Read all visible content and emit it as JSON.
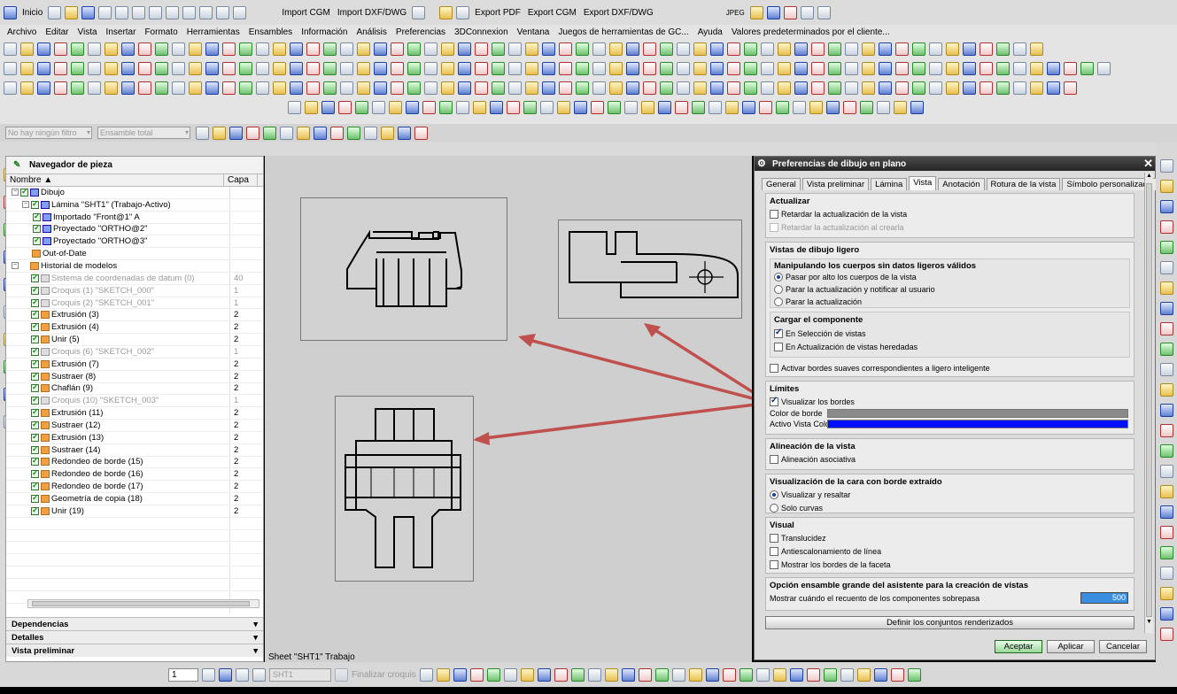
{
  "toolbar_top": {
    "start": "Inicio",
    "import_cgm": "Import CGM",
    "import_dxf": "Import DXF/DWG",
    "export_pdf": "Export PDF",
    "export_cgm": "Export CGM",
    "export_dxf": "Export DXF/DWG",
    "jpeg": "JPEG"
  },
  "menu": [
    "Archivo",
    "Editar",
    "Vista",
    "Insertar",
    "Formato",
    "Herramientas",
    "Ensambles",
    "Información",
    "Análisis",
    "Preferencias",
    "3DConnexion",
    "Ventana",
    "Juegos de herramientas de GC...",
    "Ayuda",
    "Valores predeterminados por el cliente..."
  ],
  "filter": {
    "filter_placeholder": "No hay ningún filtro",
    "scope": "Ensamble total"
  },
  "navigator": {
    "title": "Navegador de pieza",
    "col_name": "Nombre",
    "col_layer": "Capa",
    "rows": [
      {
        "label": "Dibujo",
        "layer": "",
        "level": 0
      },
      {
        "label": "Lámina \"SHT1\" (Trabajo-Activo)",
        "layer": "",
        "level": 1
      },
      {
        "label": "Importado \"Front@1\" A",
        "layer": "",
        "level": 2
      },
      {
        "label": "Proyectado \"ORTHO@2\"",
        "layer": "",
        "level": 2
      },
      {
        "label": "Proyectado \"ORTHO@3\"",
        "layer": "",
        "level": 2
      },
      {
        "label": "Out-of-Date",
        "layer": "",
        "level": 1
      },
      {
        "label": "Historial de modelos",
        "layer": "",
        "level": 0
      },
      {
        "label": "Sistema de coordenadas de datum (0)",
        "layer": "40",
        "level": 1,
        "dim": true
      },
      {
        "label": "Croquis (1) \"SKETCH_000\"",
        "layer": "1",
        "level": 1,
        "dim": true
      },
      {
        "label": "Croquis (2) \"SKETCH_001\"",
        "layer": "1",
        "level": 1,
        "dim": true
      },
      {
        "label": "Extrusión (3)",
        "layer": "2",
        "level": 1
      },
      {
        "label": "Extrusión (4)",
        "layer": "2",
        "level": 1
      },
      {
        "label": "Unir (5)",
        "layer": "2",
        "level": 1
      },
      {
        "label": "Croquis (6) \"SKETCH_002\"",
        "layer": "1",
        "level": 1,
        "dim": true
      },
      {
        "label": "Extrusión (7)",
        "layer": "2",
        "level": 1
      },
      {
        "label": "Sustraer (8)",
        "layer": "2",
        "level": 1
      },
      {
        "label": "Chaflán (9)",
        "layer": "2",
        "level": 1
      },
      {
        "label": "Croquis (10) \"SKETCH_003\"",
        "layer": "1",
        "level": 1,
        "dim": true
      },
      {
        "label": "Extrusión (11)",
        "layer": "2",
        "level": 1
      },
      {
        "label": "Sustraer (12)",
        "layer": "2",
        "level": 1
      },
      {
        "label": "Extrusión (13)",
        "layer": "2",
        "level": 1
      },
      {
        "label": "Sustraer (14)",
        "layer": "2",
        "level": 1
      },
      {
        "label": "Redondeo de borde (15)",
        "layer": "2",
        "level": 1
      },
      {
        "label": "Redondeo de borde (16)",
        "layer": "2",
        "level": 1
      },
      {
        "label": "Redondeo de borde (17)",
        "layer": "2",
        "level": 1
      },
      {
        "label": "Geometría de copia (18)",
        "layer": "2",
        "level": 1
      },
      {
        "label": "Unir (19)",
        "layer": "2",
        "level": 1
      }
    ],
    "sections": [
      "Dependencias",
      "Detalles",
      "Vista preliminar"
    ]
  },
  "canvas": {
    "status": "Sheet \"SHT1\" Trabajo"
  },
  "dialog": {
    "title": "Preferencias de dibujo en plano",
    "tabs": [
      "General",
      "Vista preliminar",
      "Lámina",
      "Vista",
      "Anotación",
      "Rotura de la vista",
      "Símbolo personalizado"
    ],
    "active_tab": "Vista",
    "actualizar": {
      "title": "Actualizar",
      "delay": "Retardar la actualización de la vista",
      "delay_create": "Retardar la actualización al crearla"
    },
    "ligero": {
      "title": "Vistas de dibujo ligero",
      "sub1": "Manipulando los cuerpos sin datos ligeros válidos",
      "r1": "Pasar por alto los cuerpos de la vista",
      "r2": "Parar la actualización y notificar al usuario",
      "r3": "Parar la actualización",
      "sub2": "Cargar el componente",
      "c1": "En Selección de vistas",
      "c2": "En Actualización de vistas heredadas",
      "smooth": "Activar bordes suaves correspondientes a ligero inteligente"
    },
    "limites": {
      "title": "Límites",
      "show": "Visualizar los bordes",
      "border_color_label": "Color de borde",
      "active_color_label": "Activo Vista Color",
      "border_color": "#8a8a8a",
      "active_color": "#0010ff"
    },
    "alineacion": {
      "title": "Alineación de la vista",
      "assoc": "Alineación asociativa"
    },
    "cara": {
      "title": "Visualización de la cara con borde extraído",
      "r1": "Visualizar y resaltar",
      "r2": "Solo curvas"
    },
    "visual": {
      "title": "Visual",
      "t": "Translucidez",
      "a": "Antiescalonamiento de línea",
      "f": "Mostrar los bordes de la faceta"
    },
    "ensamble": {
      "title": "Opción ensamble grande del asistente para la creación de vistas",
      "label": "Mostrar cuándo el recuento de los componentes sobrepasa",
      "value": "500"
    },
    "define_btn": "Definir los conjuntos renderizados",
    "ok": "Aceptar",
    "apply": "Aplicar",
    "cancel": "Cancelar"
  },
  "bottom": {
    "page": "1",
    "sheet": "SHT1",
    "finish": "Finalizar croquis"
  }
}
